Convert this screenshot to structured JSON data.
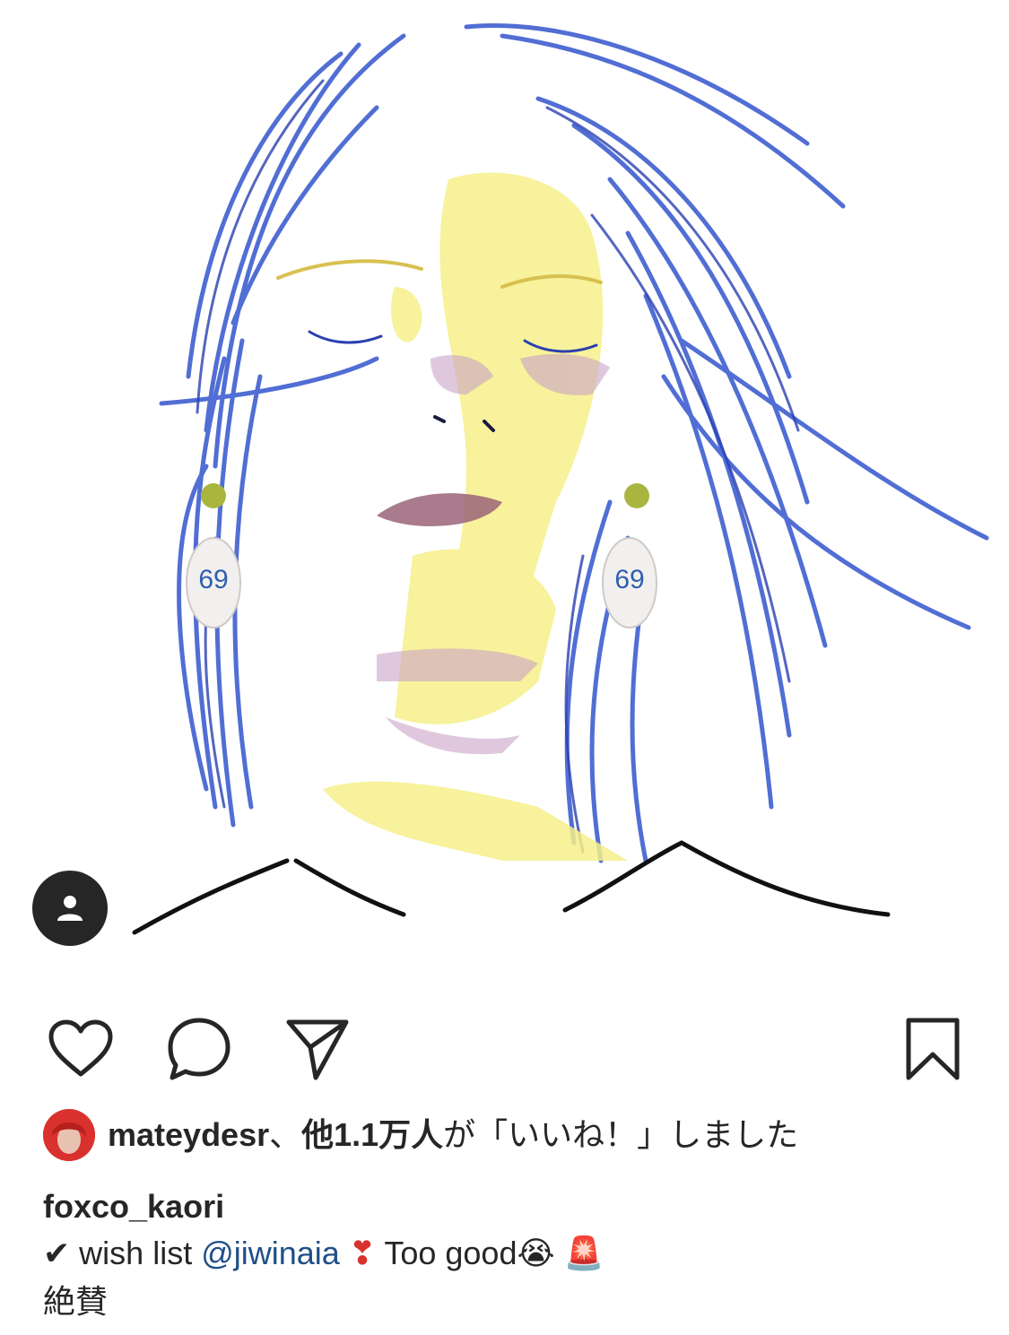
{
  "post": {
    "image": {
      "earring_number_left": "69",
      "earring_number_right": "69",
      "hair_color": "#3f5fd0",
      "skin_highlight_color": "#f6f08a",
      "shadow_color": "#c9a3c6"
    },
    "user_tag_icon": "person-icon"
  },
  "actions": {
    "like_icon": "heart-icon",
    "comment_icon": "comment-bubble-icon",
    "share_icon": "paper-plane-icon",
    "save_icon": "bookmark-icon"
  },
  "likes": {
    "liker_name": "mateydesr",
    "separator": "、",
    "others_count": "他1.1万人",
    "suffix": "が「いいね！」しました"
  },
  "caption": {
    "username": "foxco_kaori",
    "check": "✔",
    "text_before": " wish list ",
    "mention": "@jiwinaia",
    "exclamation": " ❣",
    "text_after": " Too good",
    "emoji_cry": "😭",
    "emoji_siren": " 🚨",
    "second_line": "絶賛"
  },
  "colors": {
    "text": "#262626",
    "mention": "#1f4f87",
    "tag_button": "#262626"
  }
}
